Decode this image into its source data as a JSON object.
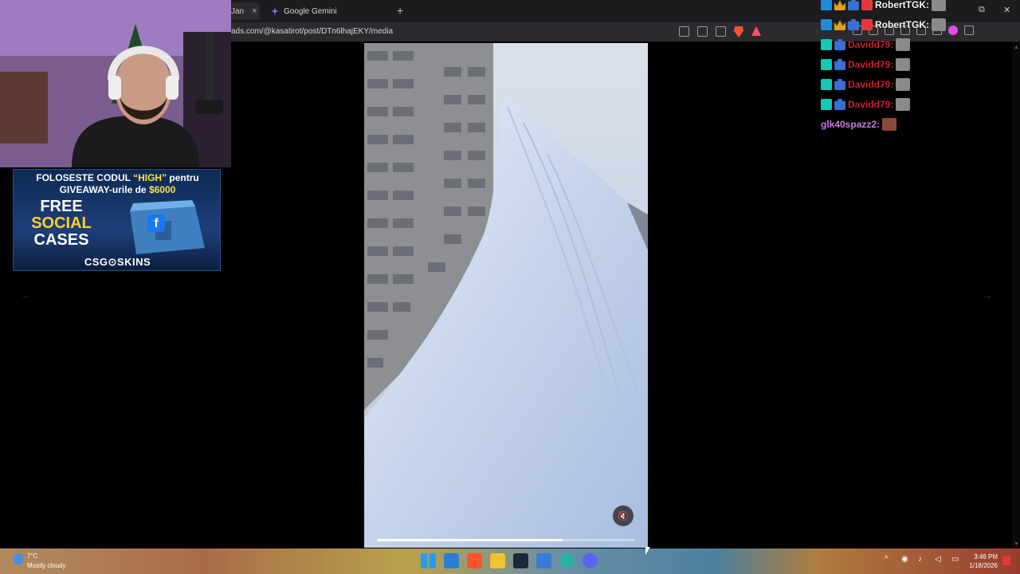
{
  "browser": {
    "active_tab_label": "Jan",
    "active_tab_close": "×",
    "tabs": [
      {
        "label": "Google Gemini"
      }
    ],
    "new_tab": "+",
    "url": "ads.com/@kasatirot/post/DTn6lhajEKY/media",
    "window_controls": {
      "restore": "⧉",
      "close": "✕"
    }
  },
  "viewer": {
    "prev_arrow": "←",
    "next_arrow": "→",
    "mute_icon": "🔇",
    "progress": 0.72
  },
  "ad": {
    "line1_prefix": "FOLOSESTE CODUL ",
    "code": "“HIGH”",
    "line1_suffix": " pentru",
    "line2_prefix": "GIVEAWAY-urile de ",
    "amount": "$6000",
    "free": "FREE",
    "social": "SOCIAL",
    "cases": "CASES",
    "brand": "CSG⊙SKINS",
    "fb": "f"
  },
  "chat": {
    "messages": [
      {
        "name": "RobertTGK:",
        "color": "white"
      },
      {
        "name": "RobertTGK:",
        "color": "white"
      },
      {
        "name": "Davidd79:",
        "color": "red"
      },
      {
        "name": "Davidd79:",
        "color": "red"
      },
      {
        "name": "Davidd79:",
        "color": "red"
      },
      {
        "name": "Davidd79:",
        "color": "red"
      },
      {
        "name": "glk40spazz2:",
        "color": "purple"
      }
    ]
  },
  "taskbar": {
    "weather_temp": "7°C",
    "weather_desc": "Mostly cloudy",
    "time": "3:46 PM",
    "date": "1/18/2026"
  }
}
